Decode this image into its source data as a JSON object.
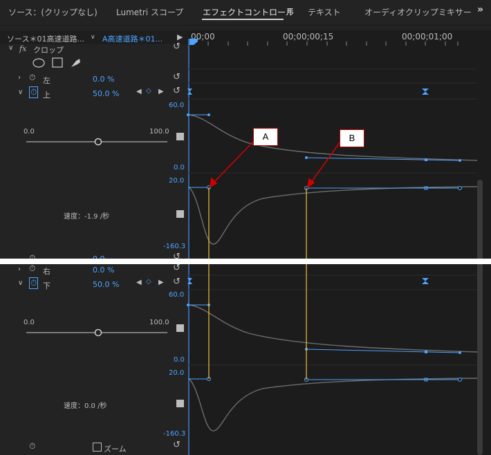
{
  "tabs": [
    {
      "label": "ソース：(クリップなし)"
    },
    {
      "label": "Lumetri スコープ"
    },
    {
      "label": "エフェクトコントロール"
    },
    {
      "label": "テキスト"
    },
    {
      "label": "オーディオクリップミキサー"
    }
  ],
  "source_row": {
    "source_label": "ソース＊01高速道路...",
    "clip_label": "A高速道路＊01..."
  },
  "timecodes": [
    "00;00",
    "00;00;00;15",
    "00;00;01;00"
  ],
  "effect": {
    "fx": "fx",
    "name": "クロップ"
  },
  "params": {
    "left": {
      "label": "左",
      "value": "0.0 %"
    },
    "top": {
      "label": "上",
      "value": "50.0 %"
    },
    "right_partial": {
      "value": "0.0"
    },
    "right": {
      "label": "右",
      "value": "0.0 %"
    },
    "bottom": {
      "label": "下",
      "value": "50.0 %"
    }
  },
  "slider_top": {
    "min": "0.0",
    "max": "100.0"
  },
  "slider_bottom": {
    "min": "0.0",
    "max": "100.0"
  },
  "graph_top": {
    "val_max": "60.0",
    "val_min": "0.0",
    "vel_max": "20.0",
    "vel_min": "-160.3",
    "velocity_text": "速度：-1.9 /秒"
  },
  "graph_bottom": {
    "val_max": "60.0",
    "val_min": "0.0",
    "vel_max": "20.0",
    "vel_min": "-160.3",
    "velocity_text": "速度：0.0 /秒"
  },
  "zoom_label": "ズーム",
  "callouts": {
    "a": "A",
    "b": "B"
  },
  "colors": {
    "accent": "#4ea5ff",
    "callout_border": "#c00000",
    "guide": "#f0c040"
  }
}
